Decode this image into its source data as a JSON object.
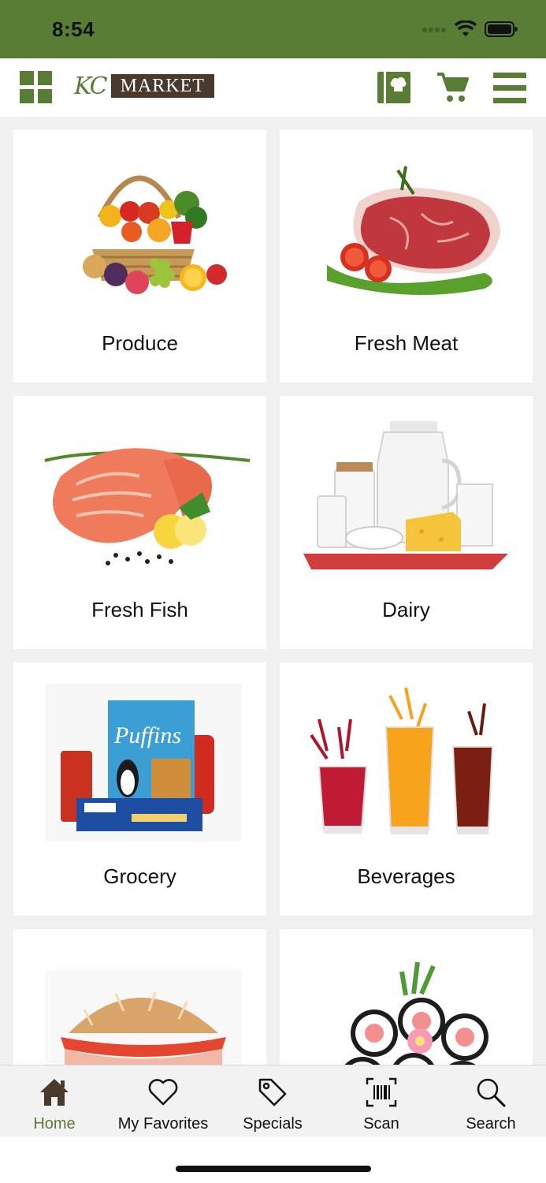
{
  "status_bar": {
    "time": "8:54",
    "icons": [
      "cellular-icon",
      "wifi-icon",
      "battery-icon"
    ]
  },
  "header": {
    "logo_script": "KC",
    "logo_text": "MARKET",
    "buttons": [
      "grid-menu-icon",
      "recipe-card-icon",
      "cart-icon",
      "hamburger-menu-icon"
    ]
  },
  "categories": [
    {
      "label": "Produce",
      "icon": "produce-basket-image"
    },
    {
      "label": "Fresh Meat",
      "icon": "steak-image"
    },
    {
      "label": "Fresh Fish",
      "icon": "salmon-image"
    },
    {
      "label": "Dairy",
      "icon": "dairy-image"
    },
    {
      "label": "Grocery",
      "icon": "grocery-boxes-image"
    },
    {
      "label": "Beverages",
      "icon": "beverages-image"
    },
    {
      "label": "",
      "icon": "sandwich-image"
    },
    {
      "label": "",
      "icon": "sushi-image"
    }
  ],
  "tabbar": {
    "tabs": [
      {
        "label": "Home",
        "icon": "home-icon",
        "active": true
      },
      {
        "label": "My Favorites",
        "icon": "heart-icon",
        "active": false
      },
      {
        "label": "Specials",
        "icon": "tag-icon",
        "active": false
      },
      {
        "label": "Scan",
        "icon": "barcode-scan-icon",
        "active": false
      },
      {
        "label": "Search",
        "icon": "search-icon",
        "active": false
      }
    ]
  },
  "colors": {
    "brand_green": "#5a7d35",
    "logo_brown": "#4a3a2e",
    "background": "#f0f0f0"
  }
}
